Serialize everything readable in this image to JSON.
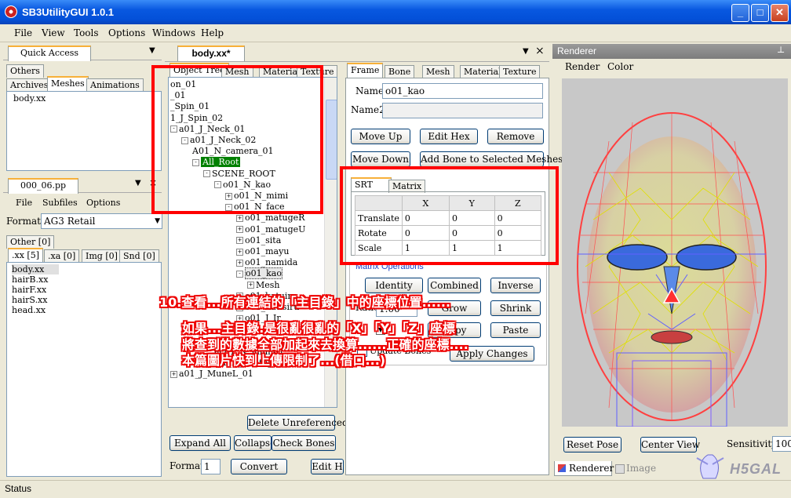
{
  "window": {
    "title": "SB3UtilityGUI 1.0.1"
  },
  "menu": [
    "File",
    "View",
    "Tools",
    "Options",
    "Windows",
    "Help"
  ],
  "quick_access": {
    "title": "Quick Access",
    "tabs": [
      "Others",
      "Archives",
      "Meshes",
      "Animations"
    ],
    "items": [
      "body.xx"
    ]
  },
  "pp_panel": {
    "title": "000_06.pp",
    "menu": [
      "File",
      "Subfiles",
      "Options"
    ],
    "format_label": "Format",
    "format_value": "AG3 Retail",
    "tabs": [
      "Other [0]",
      ".xx [5]",
      ".xa [0]",
      "Img [0]",
      "Snd [0]"
    ],
    "files": [
      "body.xx",
      "hairB.xx",
      "hairF.xx",
      "hairS.xx",
      "head.xx"
    ]
  },
  "editor": {
    "title": "body.xx*",
    "left_tabs": [
      "Object Tree",
      "Mesh",
      "Material",
      "Texture"
    ],
    "tree": [
      {
        "indent": 0,
        "label": "on_01",
        "pm": ""
      },
      {
        "indent": 0,
        "label": "_01",
        "pm": ""
      },
      {
        "indent": 0,
        "label": "_Spin_01",
        "pm": ""
      },
      {
        "indent": 0,
        "label": "1_J_Spin_02",
        "pm": ""
      },
      {
        "indent": 0,
        "label": "a01_J_Neck_01",
        "pm": "-"
      },
      {
        "indent": 1,
        "label": "a01_J_Neck_02",
        "pm": "-"
      },
      {
        "indent": 2,
        "label": "A01_N_camera_01",
        "pm": ""
      },
      {
        "indent": 2,
        "label": "All_Root",
        "pm": "-",
        "selected": true
      },
      {
        "indent": 3,
        "label": "SCENE_ROOT",
        "pm": "-"
      },
      {
        "indent": 4,
        "label": "o01_N_kao",
        "pm": "-"
      },
      {
        "indent": 5,
        "label": "o01_N_mimi",
        "pm": "+"
      },
      {
        "indent": 5,
        "label": "o01_N_face",
        "pm": "-"
      },
      {
        "indent": 6,
        "label": "o01_matugeR",
        "pm": "+"
      },
      {
        "indent": 6,
        "label": "o01_matugeU",
        "pm": "+"
      },
      {
        "indent": 6,
        "label": "o01_sita",
        "pm": "+"
      },
      {
        "indent": 6,
        "label": "o01_mayu",
        "pm": "+"
      },
      {
        "indent": 6,
        "label": "o01_namida",
        "pm": "+"
      },
      {
        "indent": 6,
        "label": "o01_kao",
        "pm": "-",
        "boxed": true
      },
      {
        "indent": 7,
        "label": "Mesh",
        "pm": "+"
      },
      {
        "indent": 6,
        "label": "o01_katuiru",
        "pm": "+"
      },
      {
        "indent": 6,
        "label": "o01_kutisiru",
        "pm": "+"
      },
      {
        "indent": 6,
        "label": "o01_J_Ir",
        "pm": "+"
      },
      {
        "indent": 6,
        "label": "",
        "pm": ""
      },
      {
        "indent": 5,
        "label": "",
        "pm": ""
      },
      {
        "indent": 4,
        "label": "ac01_N_mimi01",
        "pm": ""
      },
      {
        "indent": 3,
        "label": "s01_N_kaotop",
        "pm": "+"
      },
      {
        "indent": 0,
        "label": "a01_J_MuneL_01",
        "pm": "+"
      }
    ],
    "buttons": {
      "delete_unreferenced": "Delete Unreferenced",
      "expand_all": "Expand All",
      "collapse_all": "Collapse",
      "check_bones": "Check Bones",
      "format_label": "Format",
      "format_value": "1",
      "convert": "Convert",
      "edit": "Edit H"
    },
    "right_tabs": [
      "Frame",
      "Bone",
      "Mesh",
      "Material",
      "Texture"
    ],
    "name_label": "Name",
    "name_value": "o01_kao",
    "name2_label": "Name2",
    "name2_value": "",
    "frame_buttons": [
      "Move Up",
      "Edit Hex",
      "Remove",
      "Move Down",
      "Add Bone to Selected Meshes"
    ],
    "srt_tabs": [
      "SRT",
      "Matrix"
    ],
    "srt_columns": [
      "X",
      "Y",
      "Z"
    ],
    "srt_rows": [
      {
        "label": "Translate",
        "values": [
          "0",
          "0",
          "0"
        ]
      },
      {
        "label": "Rotate",
        "values": [
          "0",
          "0",
          "0"
        ]
      },
      {
        "label": "Scale",
        "values": [
          "1",
          "1",
          "1"
        ]
      }
    ],
    "matrix_ops": {
      "title": "Matrix Operations",
      "buttons": [
        "Identity",
        "Combined",
        "Inverse",
        "Grow",
        "Shrink",
        "Copy",
        "Paste",
        "Apply Changes"
      ],
      "ratio_label": "Ratio",
      "ratio_value": "1.00",
      "update_label": "Update Bones"
    }
  },
  "renderer": {
    "title": "Renderer",
    "menu": [
      "Render",
      "Color"
    ],
    "reset_pose": "Reset Pose",
    "center_view": "Center View",
    "sensitivity_label": "Sensitivity",
    "sensitivity_value": "100",
    "bottom_tabs": [
      "Renderer",
      "Image"
    ]
  },
  "annotation": {
    "line1": "10.查看...所有連結的「主目錄」中的座標位置......",
    "line2": "如果...主目錄.是很亂很亂的「X」「Y」「Z」座標",
    "line3": "將查到的數據全部加起來去換算......正確的座標....",
    "line4": "本篇圖片快到上傳限制了...(借口...)"
  },
  "watermark": "H5GAL",
  "status": "Status",
  "colors": {
    "title_blue": "#0350D8",
    "annotation_red": "#FF0000",
    "selected_node": "#008000"
  }
}
